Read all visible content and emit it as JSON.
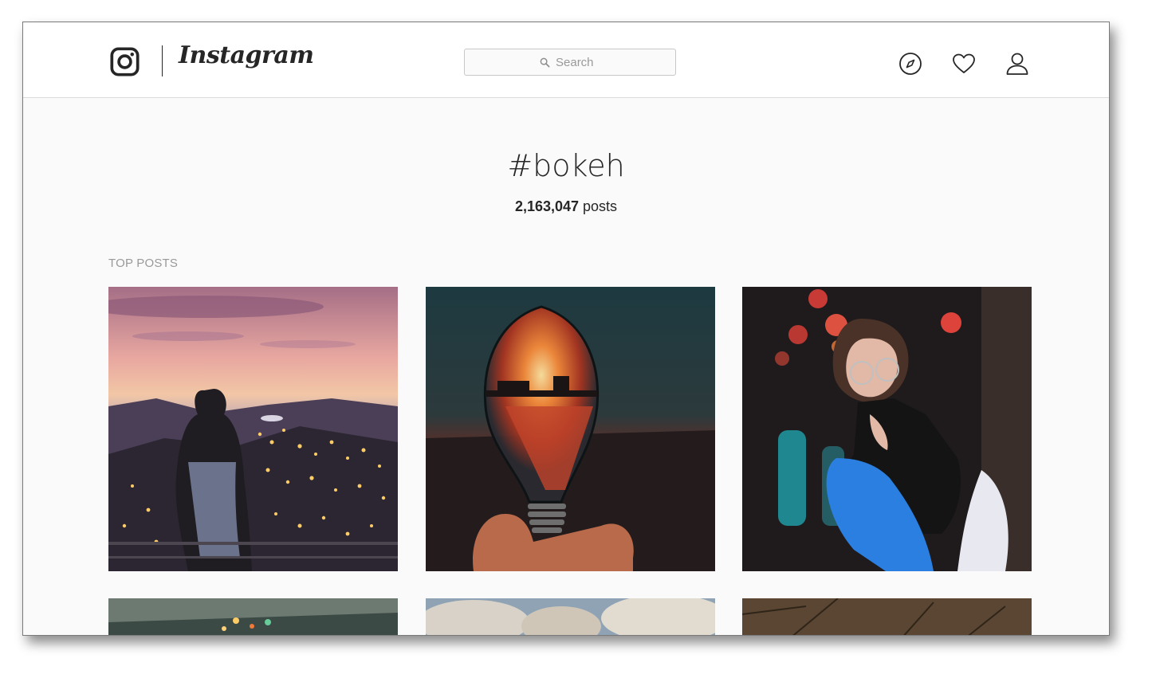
{
  "header": {
    "brand": "Instagram",
    "search": {
      "placeholder": "Search"
    },
    "icons": [
      "instagram-logo-icon",
      "compass-icon",
      "heart-icon",
      "profile-icon"
    ]
  },
  "hashtag": {
    "title": "#bokeh",
    "post_count": "2,163,047",
    "post_count_suffix": " posts"
  },
  "section": {
    "label": "TOP POSTS"
  },
  "posts": [
    {
      "subject": "woman overlooking city lights at dusk"
    },
    {
      "subject": "hand holding light bulb with sunset reflection"
    },
    {
      "subject": "woman with glasses and colorful bokeh lights"
    },
    {
      "subject": "string lights"
    },
    {
      "subject": "clouds"
    },
    {
      "subject": "tree branches"
    }
  ],
  "colors": {
    "text": "#262626",
    "muted": "#999999",
    "background": "#fafafa",
    "border": "#dbdbdb"
  }
}
